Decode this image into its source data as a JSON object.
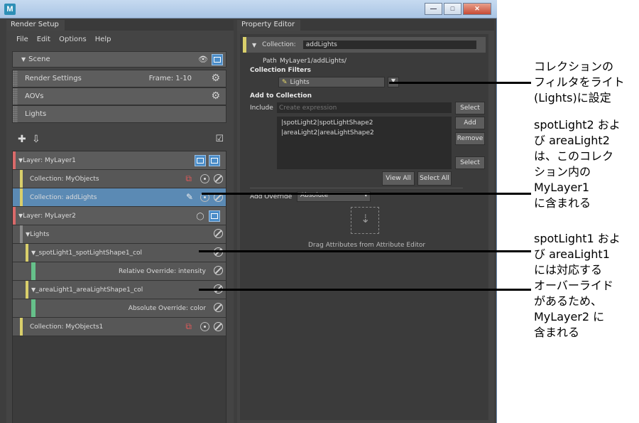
{
  "window": {
    "app_icon": "M",
    "min": "—",
    "max": "□",
    "close": "✕"
  },
  "left_panel": {
    "tab": "Render Setup",
    "menu": [
      "File",
      "Edit",
      "Options",
      "Help"
    ],
    "scene": {
      "label": "Scene"
    },
    "render_settings": {
      "label": "Render Settings",
      "frame": "Frame: 1-10"
    },
    "aovs": {
      "label": "AOVs"
    },
    "lights": {
      "label": "Lights"
    },
    "tree": {
      "layer1": {
        "label": "Layer:  MyLayer1"
      },
      "coll_myobjects": {
        "label": "Collection:  MyObjects"
      },
      "coll_addlights": {
        "label": "Collection:  addLights"
      },
      "layer2": {
        "label": "Layer:  MyLayer2"
      },
      "lights_group": {
        "label": "Lights"
      },
      "spot_col": {
        "label": "_spotLight1_spotLightShape1_col"
      },
      "rel_override": {
        "label": "Relative Override:  intensity"
      },
      "area_col": {
        "label": "_areaLight1_areaLightShape1_col"
      },
      "abs_override": {
        "label": "Absolute Override:  color"
      },
      "coll_myobjects1": {
        "label": "Collection:  MyObjects1"
      }
    }
  },
  "right_panel": {
    "tab": "Property Editor",
    "collection_label": "Collection:",
    "collection_name": "addLights",
    "path_label": "Path",
    "path_value": "MyLayer1/addLights/",
    "collection_filters": "Collection Filters",
    "filter_value": "Lights",
    "add_to_collection": "Add to Collection",
    "include_label": "Include",
    "include_placeholder": "Create expression",
    "select_btn": "Select",
    "members": [
      "|spotLight2|spotLightShape2",
      "|areaLight2|areaLightShape2"
    ],
    "add_btn": "Add",
    "remove_btn": "Remove",
    "select_btn2": "Select",
    "view_all": "View All",
    "select_all": "Select All",
    "add_override_label": "Add Override",
    "add_override_value": "Absolute",
    "drag_text": "Drag Attributes from Attribute Editor"
  },
  "annotations": {
    "note1": [
      "コレクションの",
      "フィルタをライト",
      "(Lights)に設定"
    ],
    "note2": [
      "spotLight2 およ",
      "び areaLight2",
      "は、このコレク",
      "ション内の",
      "MyLayer1",
      "に含まれる"
    ],
    "note3": [
      "spotLight1 およ",
      "び areaLight1",
      "には対応する",
      "オーバーライド",
      "があるため、",
      "MyLayer2 に",
      "含まれる"
    ]
  },
  "colors": {
    "accent_blue": "#4a8cc8",
    "layer_red": "#d96a6a",
    "collection_yellow": "#d9cf6b",
    "override_green": "#66c18a",
    "selected_row": "#5b8ab4"
  }
}
